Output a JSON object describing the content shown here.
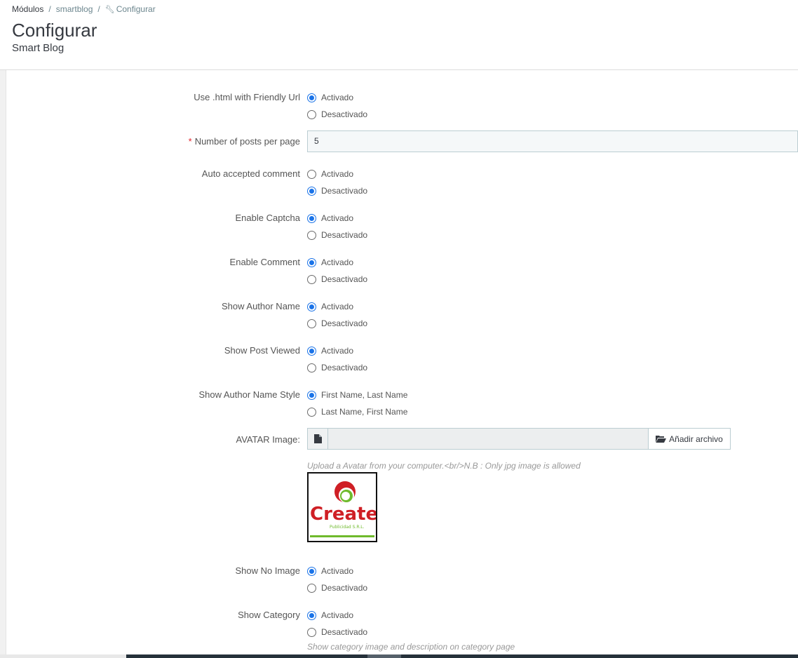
{
  "breadcrumb": {
    "item1": "Módulos",
    "item2": "smartblog",
    "item3": "Configurar",
    "sep": "/"
  },
  "page": {
    "title": "Configurar",
    "subtitle": "Smart Blog"
  },
  "fields": {
    "html_friendly": {
      "label": "Use .html with Friendly Url",
      "options": [
        "Activado",
        "Desactivado"
      ],
      "selected": "Activado"
    },
    "posts_per_page": {
      "label": "Number of posts per page",
      "required": "*",
      "value": "5"
    },
    "auto_accept": {
      "label": "Auto accepted comment",
      "options": [
        "Activado",
        "Desactivado"
      ],
      "selected": "Desactivado"
    },
    "captcha": {
      "label": "Enable Captcha",
      "options": [
        "Activado",
        "Desactivado"
      ],
      "selected": "Activado"
    },
    "comment": {
      "label": "Enable Comment",
      "options": [
        "Activado",
        "Desactivado"
      ],
      "selected": "Activado"
    },
    "author_name": {
      "label": "Show Author Name",
      "options": [
        "Activado",
        "Desactivado"
      ],
      "selected": "Activado"
    },
    "post_viewed": {
      "label": "Show Post Viewed",
      "options": [
        "Activado",
        "Desactivado"
      ],
      "selected": "Activado"
    },
    "author_style": {
      "label": "Show Author Name Style",
      "options": [
        "First Name, Last Name",
        "Last Name, First Name"
      ],
      "selected": "First Name, Last Name"
    },
    "avatar": {
      "label": "AVATAR Image:",
      "button": "Añadir archivo",
      "help": "Upload a Avatar from your computer.<br/>N.B : Only jpg image is allowed",
      "logo_text": "Create",
      "logo_sub": "Publicidad S.R.L."
    },
    "no_image": {
      "label": "Show No Image",
      "options": [
        "Activado",
        "Desactivado"
      ],
      "selected": "Activado"
    },
    "category": {
      "label": "Show Category",
      "options": [
        "Activado",
        "Desactivado"
      ],
      "selected": "Activado",
      "help": "Show category image and description on category page"
    }
  },
  "colors": {
    "accent": "#1a73e8",
    "required": "#e4222a"
  }
}
